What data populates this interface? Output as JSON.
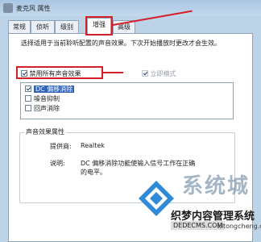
{
  "window": {
    "title": "麦克风 属性"
  },
  "tabs": [
    {
      "label": "常规",
      "active": false
    },
    {
      "label": "侦听",
      "active": false
    },
    {
      "label": "级别",
      "active": false
    },
    {
      "label": "增强",
      "active": true
    },
    {
      "label": "高级",
      "active": false
    }
  ],
  "description": "选择适用于当前聆听配置的声音效果。下次开始播放时更改才会生效。",
  "disable_all": {
    "label": "禁用所有声音效果",
    "checked": true
  },
  "immediate_mode": {
    "label": "立即模式",
    "checked": true,
    "enabled": false
  },
  "effects": [
    {
      "label": "DC 偏移消除",
      "checked": true,
      "selected": true
    },
    {
      "label": "噪音抑制",
      "checked": false,
      "selected": false
    },
    {
      "label": "回声消除",
      "checked": false,
      "selected": false
    }
  ],
  "properties": {
    "group_title": "声音效果属性",
    "provider_label": "提供商:",
    "provider_value": "Realtek",
    "description_label": "说明:",
    "description_value": "DC 偏移消除功能使输入信号工作在正确的电平。"
  },
  "watermark": {
    "text1": "系统城",
    "text2": "织梦内容管理系统",
    "text3": "DEDECMS.COM",
    "text4": "xitongcheng.com"
  },
  "colors": {
    "annotation_red": "#d5202a",
    "selection_blue": "#3064b8"
  }
}
